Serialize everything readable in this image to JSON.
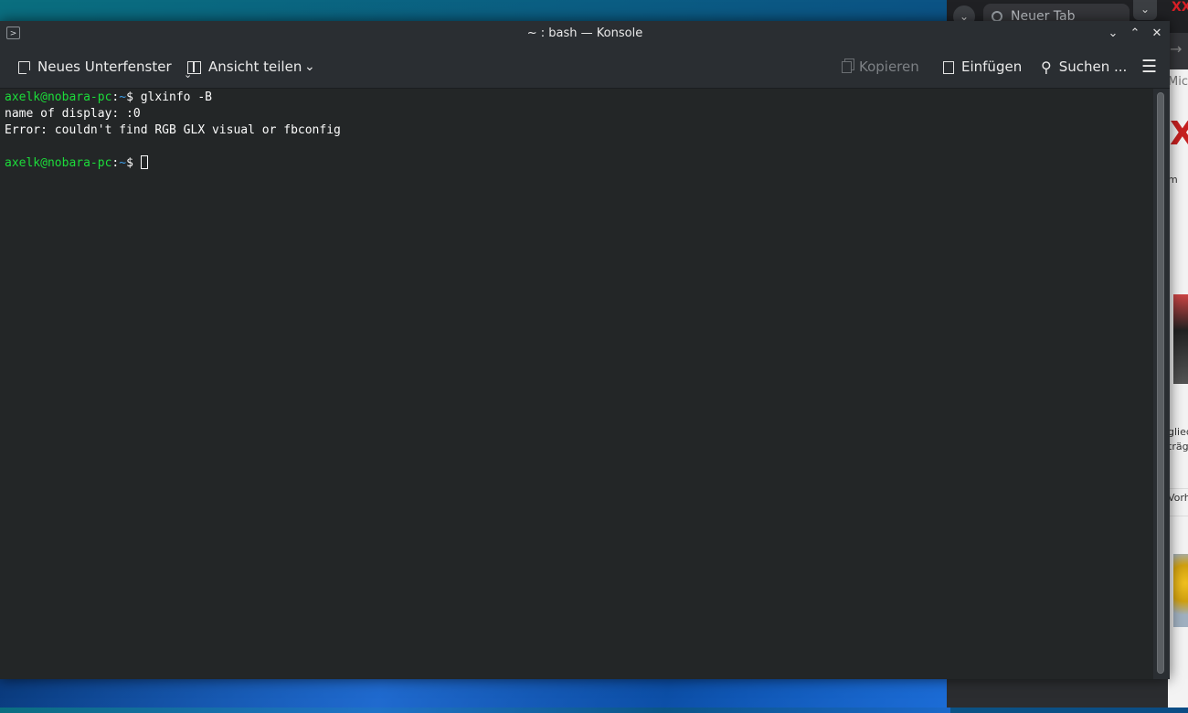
{
  "browser": {
    "tab_title": "Neuer Tab",
    "logo_text": "XX",
    "page_snippets": [
      "Micr",
      "m",
      "glied",
      "träg",
      "Vorh"
    ]
  },
  "window": {
    "title": "~ : bash — Konsole",
    "app_icon": ">",
    "minimize_icon": "⌄",
    "maximize_icon": "⌃",
    "close_icon": "✕"
  },
  "toolbar": {
    "new_tab_label": "Neues Unterfenster",
    "split_view_label": "Ansicht teilen",
    "copy_label": "Kopieren",
    "paste_label": "Einfügen",
    "search_label": "Suchen ...",
    "dropdown_icon": "⌄",
    "search_icon": "⚲",
    "menu_icon": "☰"
  },
  "terminal": {
    "user_host": "axelk@nobara-pc",
    "colon": ":",
    "path": "~",
    "dollar": "$ ",
    "command": "glxinfo -B",
    "output_line1": "name of display: :0",
    "output_line2": "Error: couldn't find RGB GLX visual or fbconfig"
  }
}
